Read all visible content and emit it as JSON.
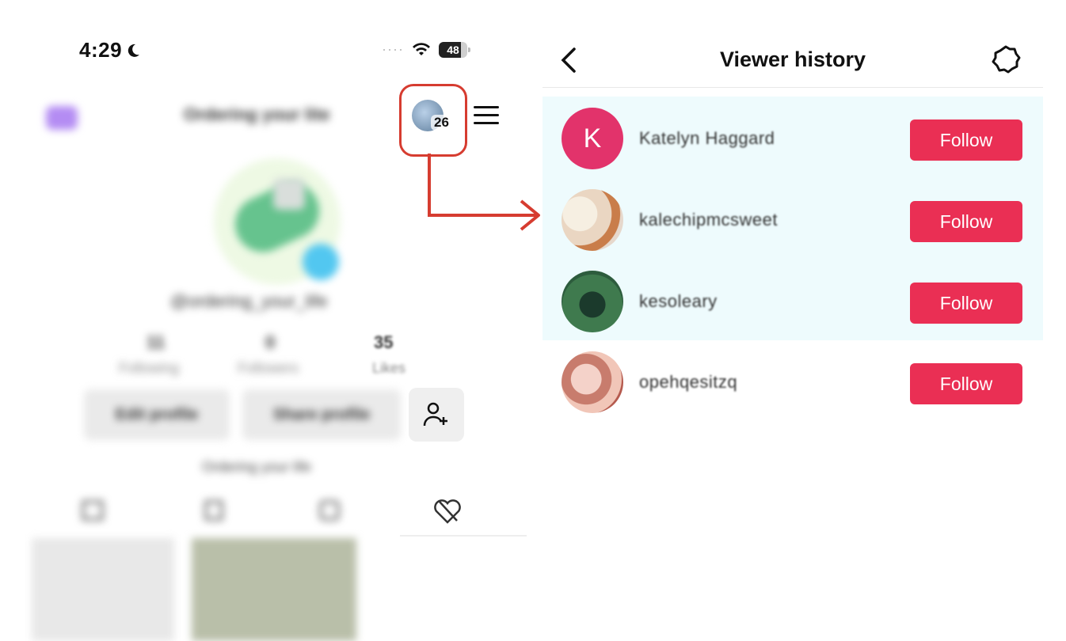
{
  "status_bar": {
    "time": "4:29",
    "battery": "48"
  },
  "profile_blurred": {
    "title": "Ordering your lite",
    "handle": "@ordering_your_life",
    "stats": [
      {
        "num": "11",
        "label": "Following"
      },
      {
        "num": "0",
        "label": "Followers"
      },
      {
        "num": "35",
        "label": "Likes"
      }
    ],
    "edit_profile": "Edit profile",
    "share_profile": "Share profile",
    "caption": "Ordering your life"
  },
  "inbox_badge": {
    "count": "26"
  },
  "viewer_history": {
    "title": "Viewer history",
    "viewers": [
      {
        "name": "Katelyn Haggard",
        "avatar_letter": "K",
        "follow_label": "Follow"
      },
      {
        "name": "kalechipmcsweet",
        "follow_label": "Follow"
      },
      {
        "name": "kesoleary",
        "follow_label": "Follow"
      },
      {
        "name": "opehqesitzq",
        "follow_label": "Follow"
      }
    ]
  },
  "colors": {
    "follow": "#ea2f54",
    "highlight": "#eefbfd",
    "annotation": "#d63c30"
  }
}
